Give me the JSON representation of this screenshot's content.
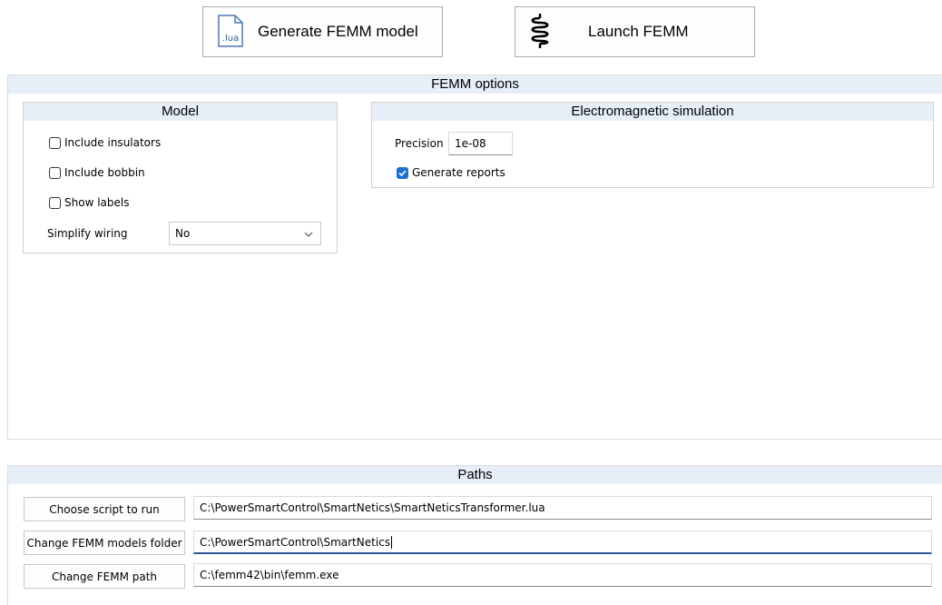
{
  "toolbar": {
    "generate_label": "Generate FEMM model",
    "lua_icon_text": ".lua",
    "launch_label": "Launch FEMM"
  },
  "femm_options": {
    "title": "FEMM options",
    "model": {
      "title": "Model",
      "include_insulators": {
        "label": "Include insulators",
        "checked": false
      },
      "include_bobbin": {
        "label": "Include bobbin",
        "checked": false
      },
      "show_labels": {
        "label": "Show labels",
        "checked": false
      },
      "simplify_wiring": {
        "label": "Simplify wiring",
        "value": "No"
      }
    },
    "em_sim": {
      "title": "Electromagnetic simulation",
      "precision_label": "Precision",
      "precision_value": "1e-08",
      "generate_reports": {
        "label": "Generate reports",
        "checked": true
      }
    }
  },
  "paths": {
    "title": "Paths",
    "rows": [
      {
        "button": "Choose script to run",
        "value": "C:\\PowerSmartControl\\SmartNetics\\SmartNeticsTransformer.lua"
      },
      {
        "button": "Change FEMM models folder",
        "value": "C:\\PowerSmartControl\\SmartNetics"
      },
      {
        "button": "Change FEMM path",
        "value": "C:\\femm42\\bin\\femm.exe"
      }
    ]
  },
  "colors": {
    "header_bg": "#e6eef8",
    "accent": "#1f6fd1"
  }
}
